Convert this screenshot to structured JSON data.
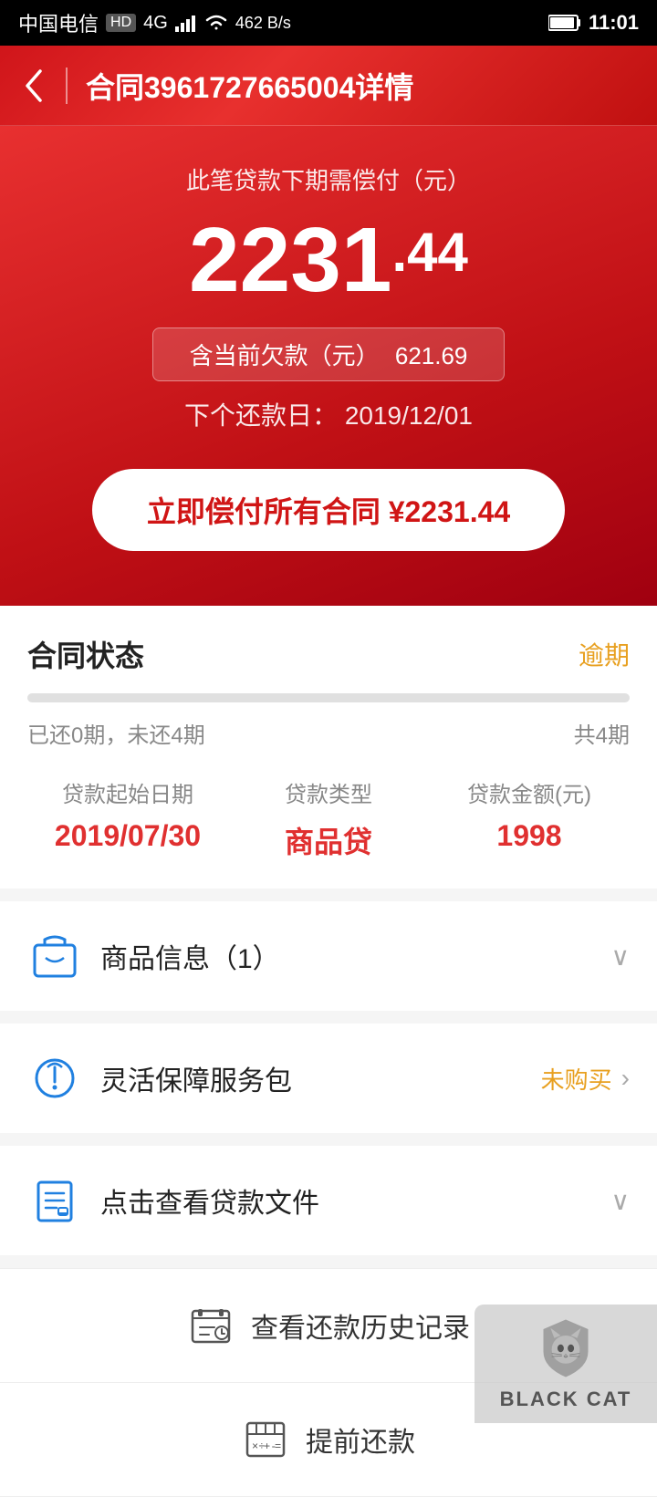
{
  "statusBar": {
    "carrier": "中国电信",
    "hd": "HD",
    "network": "4G",
    "speed": "462 B/s",
    "time": "11:01"
  },
  "header": {
    "backLabel": "←",
    "title": "合同3961727665004详情"
  },
  "hero": {
    "subtitle": "此笔贷款下期需偿付（元）",
    "amountInteger": "2231",
    "amountDecimal": ".44",
    "overdueLabel": "含当前欠款（元）",
    "overdueAmount": "621.69",
    "nextDateLabel": "下个还款日：",
    "nextDate": "2019/12/01",
    "payButtonLabel": "立即偿付所有合同 ¥2231.44"
  },
  "contractStatus": {
    "sectionTitle": "合同状态",
    "statusBadge": "逾期",
    "progressPaid": 0,
    "progressTotal": 4,
    "paidLabel": "已还0期，未还4期",
    "totalLabel": "共4期"
  },
  "loanInfo": {
    "items": [
      {
        "label": "贷款起始日期",
        "value": "2019/07/30"
      },
      {
        "label": "贷款类型",
        "value": "商品贷"
      },
      {
        "label": "贷款金额(元)",
        "value": "1998"
      }
    ]
  },
  "productInfo": {
    "label": "商品信息（1）",
    "arrowIcon": "chevron-down"
  },
  "servicePackage": {
    "label": "灵活保障服务包",
    "statusLabel": "未购买",
    "arrowIcon": "chevron-right"
  },
  "loanDoc": {
    "label": "点击查看贷款文件",
    "arrowIcon": "chevron-down"
  },
  "bottomActions": {
    "historyLabel": "查看还款历史记录",
    "prepayLabel": "提前还款"
  },
  "watermark": {
    "text": "BLACK CAT"
  }
}
